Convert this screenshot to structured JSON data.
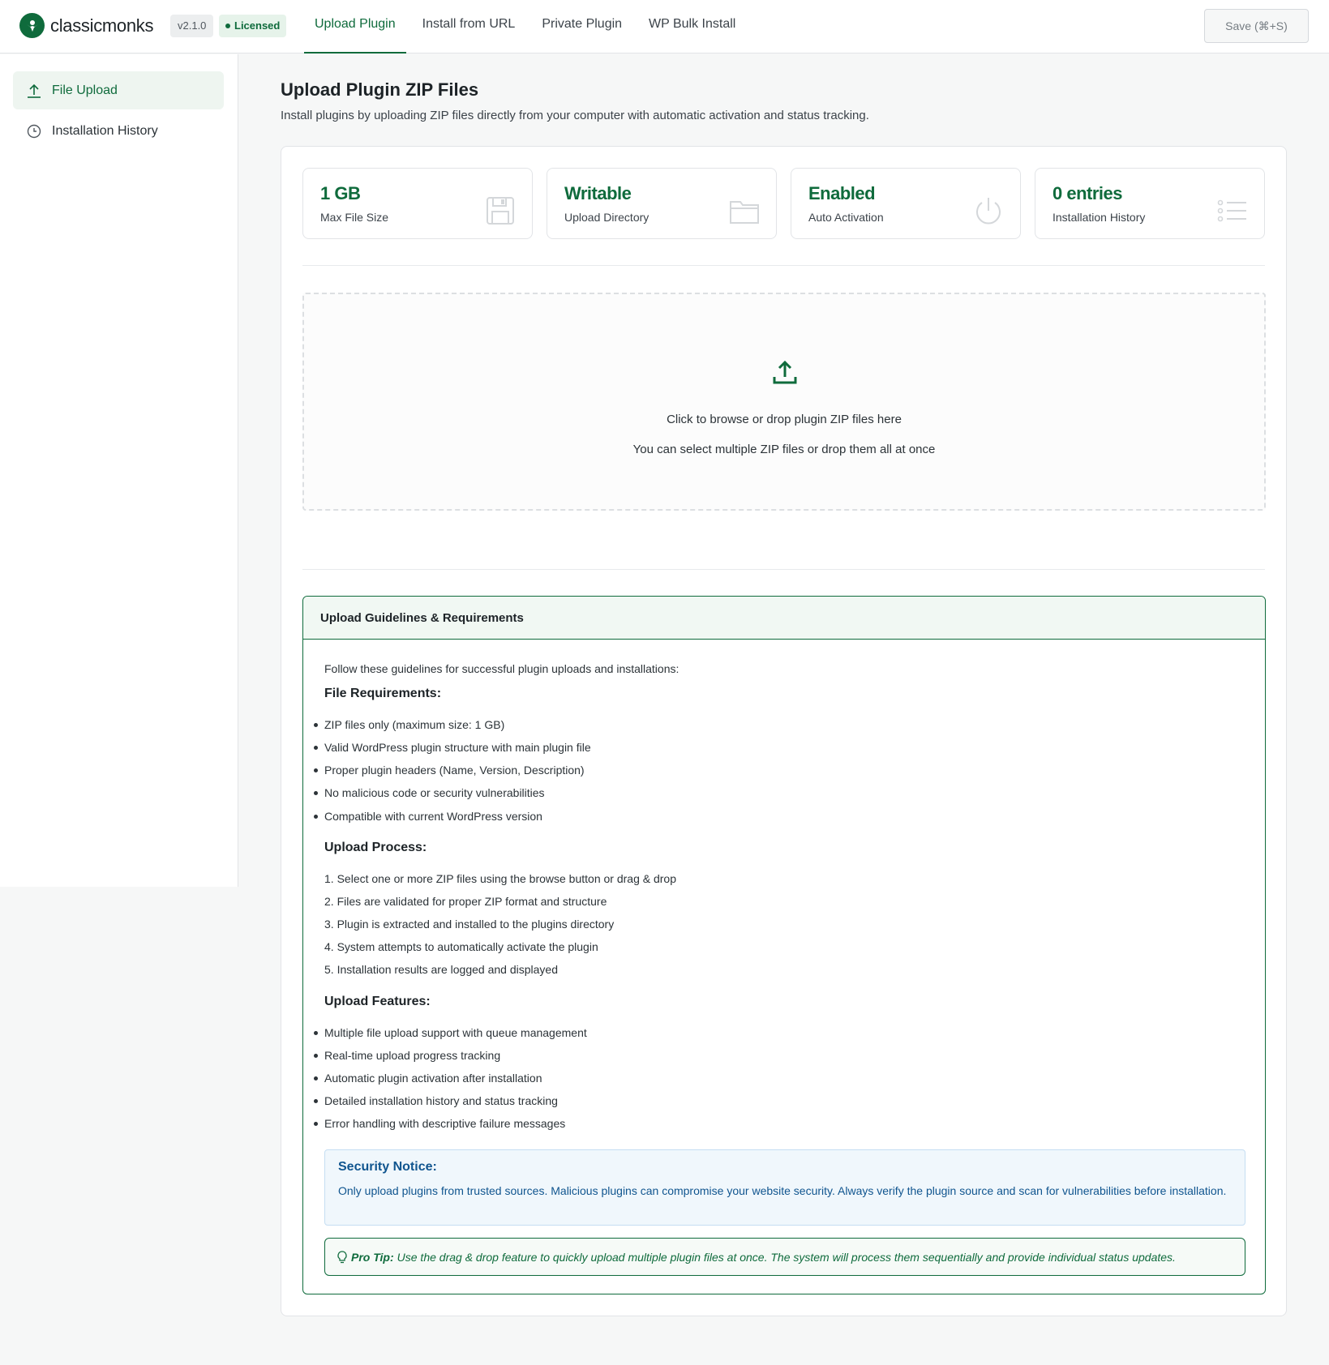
{
  "brand": {
    "name": "classicmonks",
    "version": "v2.1.0",
    "license": "Licensed"
  },
  "tabs": [
    {
      "label": "Upload Plugin",
      "active": true
    },
    {
      "label": "Install from URL",
      "active": false
    },
    {
      "label": "Private Plugin",
      "active": false
    },
    {
      "label": "WP Bulk Install",
      "active": false
    }
  ],
  "save_label": "Save (⌘+S)",
  "sidebar": {
    "items": [
      {
        "label": "File Upload",
        "icon": "upload-icon",
        "active": true
      },
      {
        "label": "Installation History",
        "icon": "clock-icon",
        "active": false
      }
    ]
  },
  "main": {
    "title": "Upload Plugin ZIP Files",
    "subtitle": "Install plugins by uploading ZIP files directly from your computer with automatic activation and status tracking."
  },
  "stats": [
    {
      "value": "1 GB",
      "label": "Max File Size",
      "icon": "floppy-disk-icon"
    },
    {
      "value": "Writable",
      "label": "Upload Directory",
      "icon": "folder-icon"
    },
    {
      "value": "Enabled",
      "label": "Auto Activation",
      "icon": "power-icon"
    },
    {
      "value": "0 entries",
      "label": "Installation History",
      "icon": "list-icon"
    }
  ],
  "dropzone": {
    "line1": "Click to browse or drop plugin ZIP files here",
    "line2": "You can select multiple ZIP files or drop them all at once"
  },
  "guidelines": {
    "title": "Upload Guidelines & Requirements",
    "intro": "Follow these guidelines for successful plugin uploads and installations:",
    "file_req_title": "File Requirements:",
    "file_req": [
      "ZIP files only (maximum size: 1 GB)",
      "Valid WordPress plugin structure with main plugin file",
      "Proper plugin headers (Name, Version, Description)",
      "No malicious code or security vulnerabilities",
      "Compatible with current WordPress version"
    ],
    "process_title": "Upload Process:",
    "process": [
      "Select one or more ZIP files using the browse button or drag & drop",
      "Files are validated for proper ZIP format and structure",
      "Plugin is extracted and installed to the plugins directory",
      "System attempts to automatically activate the plugin",
      "Installation results are logged and displayed"
    ],
    "features_title": "Upload Features:",
    "features": [
      "Multiple file upload support with queue management",
      "Real-time upload progress tracking",
      "Automatic plugin activation after installation",
      "Detailed installation history and status tracking",
      "Error handling with descriptive failure messages"
    ],
    "security_title": "Security Notice:",
    "security_body": "Only upload plugins from trusted sources. Malicious plugins can compromise your website security. Always verify the plugin source and scan for vulnerabilities before installation.",
    "protip_label": "Pro Tip:",
    "protip_body": "Use the drag & drop feature to quickly upload multiple plugin files at once. The system will process them sequentially and provide individual status updates."
  },
  "colors": {
    "accent": "#0f6b3c",
    "info": "#10558f"
  }
}
